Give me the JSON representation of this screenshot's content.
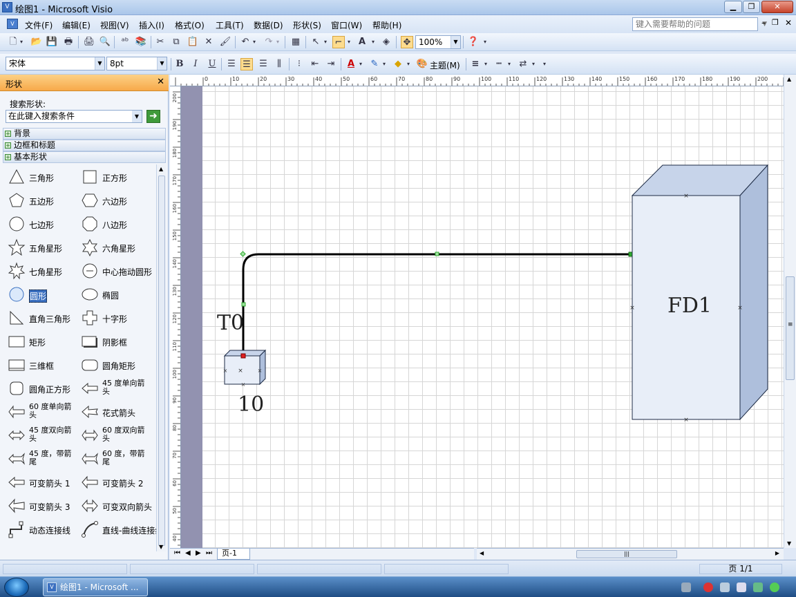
{
  "window": {
    "title": "绘图1 - Microsoft Visio",
    "icon_name": "visio-app-icon"
  },
  "menu": {
    "items": [
      "文件(F)",
      "编辑(E)",
      "视图(V)",
      "插入(I)",
      "格式(O)",
      "工具(T)",
      "数据(D)",
      "形状(S)",
      "窗口(W)",
      "帮助(H)"
    ],
    "help_placeholder": "键入需要帮助的问题"
  },
  "toolbar": {
    "zoom": "100%"
  },
  "format_toolbar": {
    "font": "宋体",
    "size": "8pt",
    "theme_label": "主题(M)"
  },
  "shapes_panel": {
    "title": "形状",
    "search_label": "搜索形状:",
    "search_placeholder": "在此键入搜索条件",
    "stencils": [
      "背景",
      "边框和标题",
      "基本形状"
    ],
    "items": [
      {
        "label": "三角形",
        "icon": "triangle-icon"
      },
      {
        "label": "正方形",
        "icon": "square-icon"
      },
      {
        "label": "五边形",
        "icon": "pentagon-icon"
      },
      {
        "label": "六边形",
        "icon": "hexagon-icon"
      },
      {
        "label": "七边形",
        "icon": "heptagon-icon"
      },
      {
        "label": "八边形",
        "icon": "octagon-icon"
      },
      {
        "label": "五角星形",
        "icon": "star5-icon"
      },
      {
        "label": "六角星形",
        "icon": "star6-icon"
      },
      {
        "label": "七角星形",
        "icon": "star7-icon"
      },
      {
        "label": "中心拖动圆形",
        "icon": "center-drag-circle-icon"
      },
      {
        "label": "圆形",
        "icon": "circle-icon",
        "selected": true
      },
      {
        "label": "椭圆",
        "icon": "ellipse-icon"
      },
      {
        "label": "直角三角形",
        "icon": "right-triangle-icon"
      },
      {
        "label": "十字形",
        "icon": "cross-icon"
      },
      {
        "label": "矩形",
        "icon": "rectangle-icon"
      },
      {
        "label": "阴影框",
        "icon": "shadow-box-icon"
      },
      {
        "label": "三维框",
        "icon": "3d-box-icon"
      },
      {
        "label": "圆角矩形",
        "icon": "rounded-rectangle-icon"
      },
      {
        "label": "圆角正方形",
        "icon": "rounded-square-icon"
      },
      {
        "label": "45 度单向箭头",
        "icon": "arrow-45-single-icon"
      },
      {
        "label": "60 度单向箭头",
        "icon": "arrow-60-single-icon"
      },
      {
        "label": "花式箭头",
        "icon": "fancy-arrow-icon"
      },
      {
        "label": "45 度双向箭头",
        "icon": "arrow-45-double-icon"
      },
      {
        "label": "60 度双向箭头",
        "icon": "arrow-60-double-icon"
      },
      {
        "label": "45 度，带箭尾",
        "icon": "arrow-45-tail-icon"
      },
      {
        "label": "60 度，带箭尾",
        "icon": "arrow-60-tail-icon"
      },
      {
        "label": "可变箭头 1",
        "icon": "variable-arrow-1-icon"
      },
      {
        "label": "可变箭头 2",
        "icon": "variable-arrow-2-icon"
      },
      {
        "label": "可变箭头 3",
        "icon": "variable-arrow-3-icon"
      },
      {
        "label": "可变双向箭头",
        "icon": "variable-double-arrow-icon"
      },
      {
        "label": "动态连接线",
        "icon": "dynamic-connector-icon"
      },
      {
        "label": "直线-曲线连接线",
        "icon": "line-curve-connector-icon"
      }
    ]
  },
  "rulers": {
    "h_ticks": [
      "0",
      "10",
      "20",
      "30",
      "40",
      "50",
      "60",
      "70",
      "80",
      "90",
      "100",
      "110",
      "120",
      "130",
      "140",
      "150",
      "160",
      "170",
      "180",
      "190",
      "200"
    ],
    "v_ticks": [
      "200",
      "190",
      "180",
      "170",
      "160",
      "150",
      "140",
      "130",
      "120",
      "110",
      "100",
      "90",
      "80",
      "70",
      "60",
      "50",
      "40"
    ]
  },
  "drawing": {
    "label_t0": "T0",
    "label_10": "10",
    "label_fd1": "FD1",
    "colors": {
      "box_face": "#e8eef8",
      "box_side": "#aebfdc",
      "connector": "#000000",
      "handle": "#2ea82e",
      "endpoint": "#e02020"
    }
  },
  "page_tabs": {
    "current": "页-1"
  },
  "status": {
    "page": "页 1/1"
  },
  "taskbar": {
    "item": "绘图1 - Microsoft ..."
  }
}
